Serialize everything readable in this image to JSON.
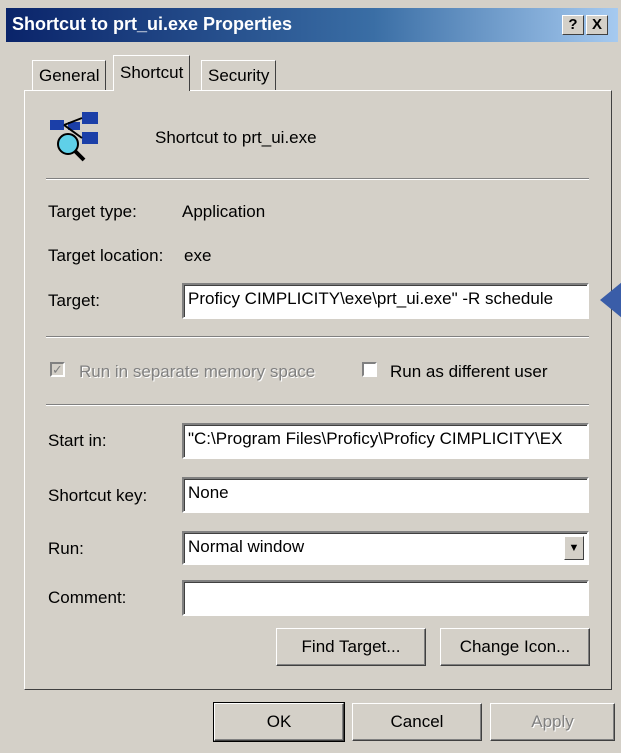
{
  "window": {
    "title": "Shortcut to prt_ui.exe Properties",
    "help_btn": "?",
    "close_btn": "X"
  },
  "tabs": [
    {
      "label": "General",
      "active": false
    },
    {
      "label": "Shortcut",
      "active": true
    },
    {
      "label": "Security",
      "active": false
    }
  ],
  "header": {
    "icon": "network-search-icon",
    "name": "Shortcut to prt_ui.exe"
  },
  "info": {
    "target_type_label": "Target type:",
    "target_type_value": "Application",
    "target_location_label": "Target location:",
    "target_location_value": "exe",
    "target_label": "Target:",
    "target_value": "Proficy CIMPLICITY\\exe\\prt_ui.exe\" -R schedule"
  },
  "options": {
    "separate_memory_label": "Run in separate memory space",
    "separate_memory_checked": true,
    "different_user_label": "Run as different user",
    "different_user_checked": false
  },
  "fields": {
    "start_in_label": "Start in:",
    "start_in_value": "\"C:\\Program Files\\Proficy\\Proficy CIMPLICITY\\EX",
    "shortcut_key_label": "Shortcut key:",
    "shortcut_key_value": "None",
    "run_label": "Run:",
    "run_value": "Normal window",
    "comment_label": "Comment:",
    "comment_value": ""
  },
  "buttons": {
    "find_target": "Find Target...",
    "change_icon": "Change Icon...",
    "ok": "OK",
    "cancel": "Cancel",
    "apply": "Apply"
  },
  "colors": {
    "title_bar": "#0a246a",
    "dialog_face": "#d4d0c8",
    "callout_arrow": "#3a5da8"
  }
}
